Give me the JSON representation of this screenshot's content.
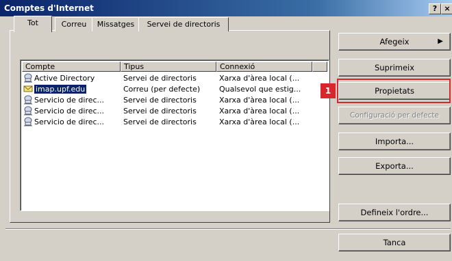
{
  "window": {
    "title": "Comptes d'Internet",
    "help_label": "?",
    "close_label": "×"
  },
  "tabs": [
    {
      "label": "Tot",
      "active": true
    },
    {
      "label": "Correu"
    },
    {
      "label": "Missatges"
    },
    {
      "label": "Servei de directoris"
    }
  ],
  "list": {
    "columns": [
      "Compte",
      "Tipus",
      "Connexió"
    ],
    "rows": [
      {
        "account": "Active Directory",
        "type": "Servei de directoris",
        "connection": "Xarxa d'àrea local (...",
        "icon": "directory-icon"
      },
      {
        "account": "imap.upf.edu",
        "type": "Correu (per defecte)",
        "connection": "Qualsevol que estig...",
        "icon": "mail-account-icon",
        "selected": true
      },
      {
        "account": "Servicio de direc...",
        "type": "Servei de directoris",
        "connection": "Xarxa d'àrea local (...",
        "icon": "directory-icon"
      },
      {
        "account": "Servicio de direc...",
        "type": "Servei de directoris",
        "connection": "Xarxa d'àrea local (...",
        "icon": "directory-icon"
      },
      {
        "account": "Servicio de direc...",
        "type": "Servei de directoris",
        "connection": "Xarxa d'àrea local (...",
        "icon": "directory-icon"
      }
    ]
  },
  "buttons": {
    "add": "Afegeix",
    "add_arrow": "▶",
    "remove": "Suprimeix",
    "properties": "Propietats",
    "set_default": "Configuració per defecte",
    "import": "Importa...",
    "export": "Exporta...",
    "order": "Defineix l'ordre...",
    "close": "Tanca"
  },
  "annotation": {
    "step": "1",
    "color": "#d9262c"
  },
  "colors": {
    "selection": "#0a246a",
    "face": "#d4d0c8"
  }
}
